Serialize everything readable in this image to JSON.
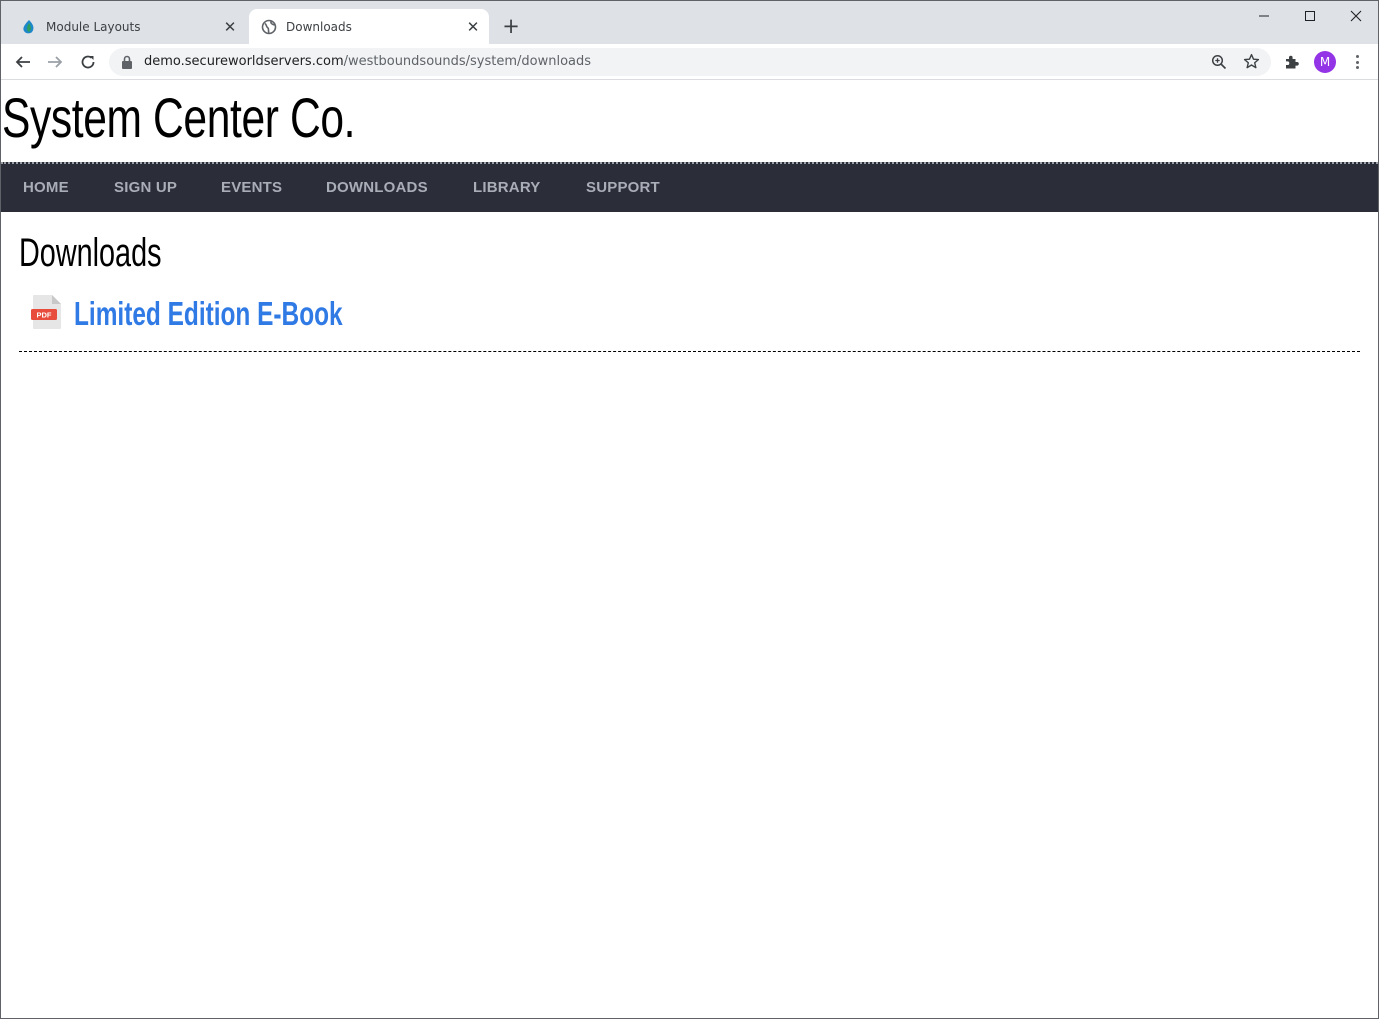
{
  "browser": {
    "tabs": [
      {
        "title": "Module Layouts",
        "active": false,
        "favicon": "leaf-icon"
      },
      {
        "title": "Downloads",
        "active": true,
        "favicon": "globe-icon"
      }
    ],
    "new_tab_label": "+",
    "address_bar": {
      "host": "demo.secureworldservers.com",
      "path": "/westboundsounds/system/downloads"
    },
    "profile_initial": "M",
    "colors": {
      "profile": "#9334e6",
      "tabstrip": "#dee1e6"
    }
  },
  "site": {
    "title": "System Center Co.",
    "nav": [
      "HOME",
      "SIGN UP",
      "EVENTS",
      "DOWNLOADS",
      "LIBRARY",
      "SUPPORT"
    ],
    "colors": {
      "nav_bg": "#2b2d39",
      "nav_text": "#a9adb6",
      "link": "#2f7ae5"
    }
  },
  "main": {
    "heading": "Downloads",
    "downloads": [
      {
        "label": "Limited Edition E-Book",
        "file_type": "PDF",
        "icon": "pdf-file-icon"
      }
    ]
  }
}
